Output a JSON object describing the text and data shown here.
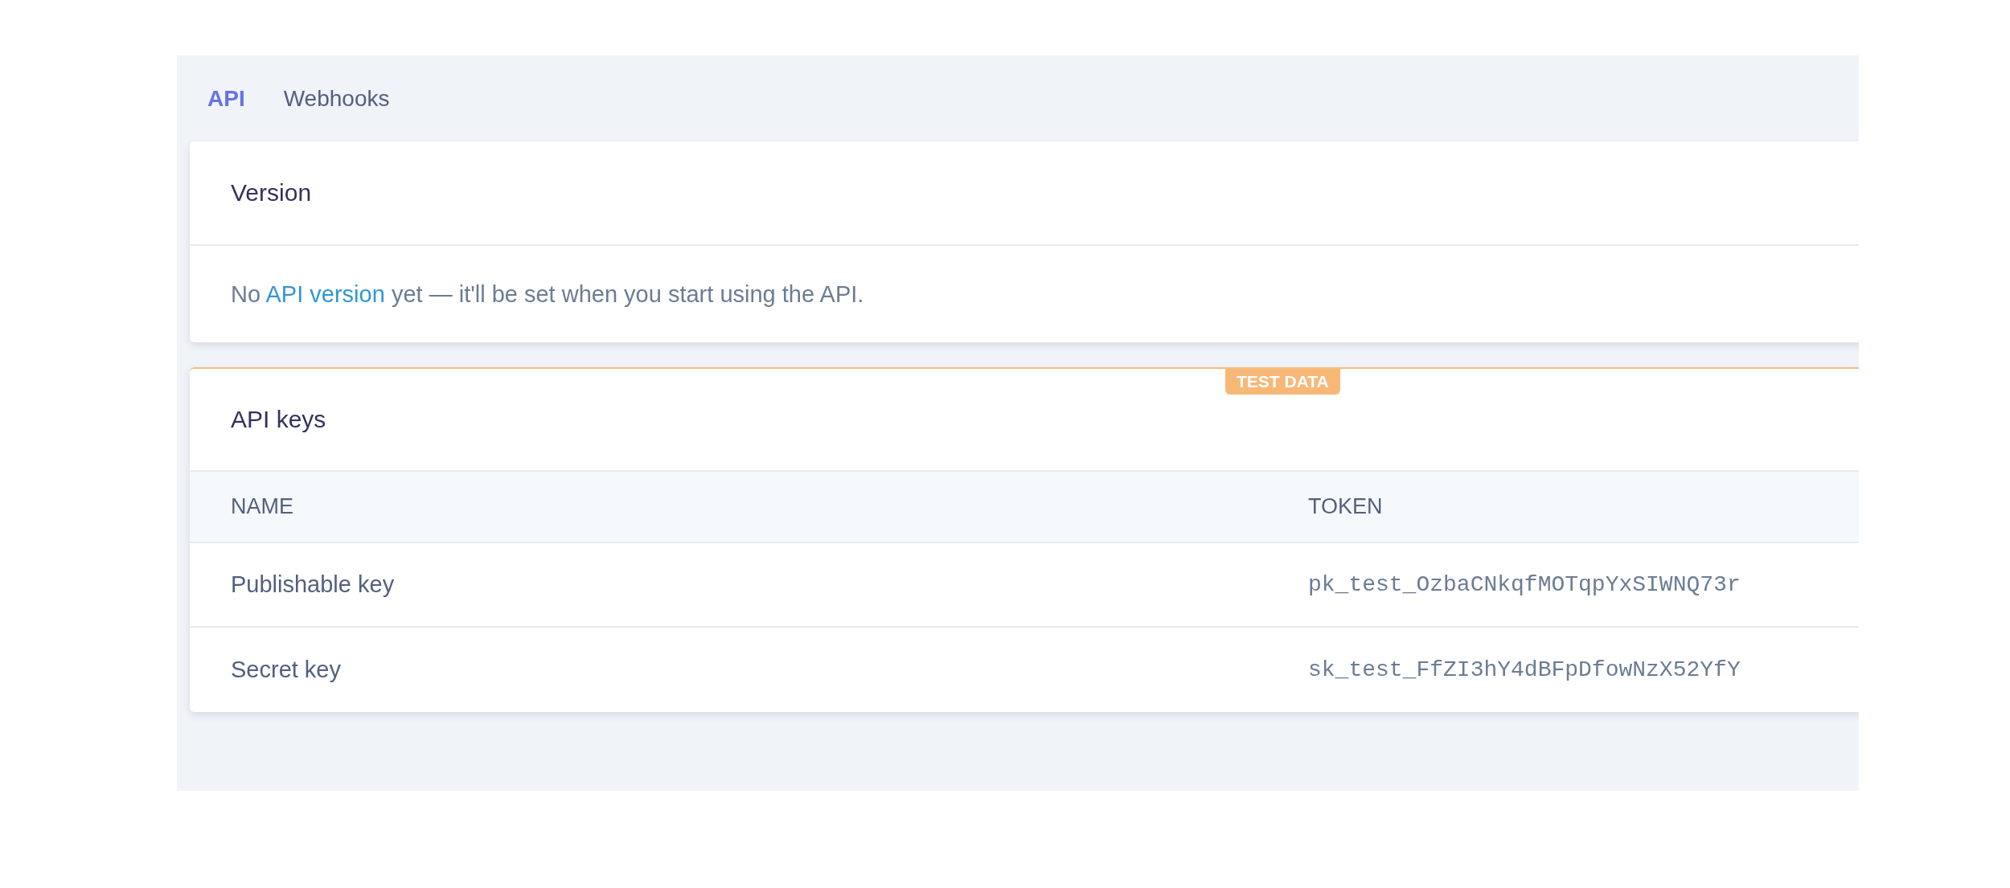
{
  "tabs": [
    {
      "label": "API",
      "selected": true
    },
    {
      "label": "Webhooks",
      "selected": false
    }
  ],
  "version_card": {
    "title": "Version",
    "message": {
      "before": "No ",
      "link": "API version",
      "after": " yet — it'll be set when you start using the API."
    }
  },
  "keys_card": {
    "badge": "TEST DATA",
    "title": "API keys",
    "columns": [
      "NAME",
      "TOKEN"
    ],
    "rows": [
      {
        "name": "Publishable key",
        "token": "pk_test_OzbaCNkqfMOTqpYxSIWNQ73r"
      },
      {
        "name": "Secret key",
        "token": "sk_test_FfZI3hY4dBFpDfowNzX52YfY"
      }
    ]
  }
}
